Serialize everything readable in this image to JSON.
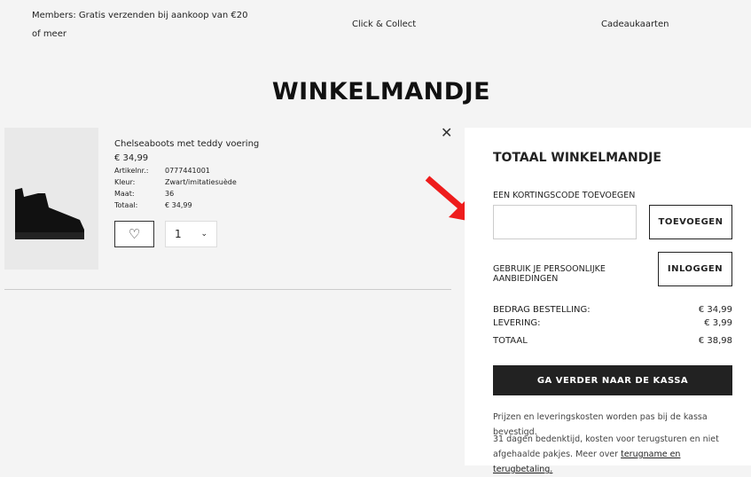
{
  "topbar": {
    "members": "Members: Gratis verzenden bij aankoop van €20",
    "members_2": "of meer",
    "click_collect": "Click & Collect",
    "giftcards": "Cadeaukaarten"
  },
  "page_title": "WINKELMANDJE",
  "item": {
    "name": "Chelseaboots met teddy voering",
    "price": "€ 34,99",
    "details": [
      {
        "label": "Artikelnr.:",
        "value": "0777441001"
      },
      {
        "label": "Kleur:",
        "value": "Zwart/imitatiesuède"
      },
      {
        "label": "Maat:",
        "value": "36"
      },
      {
        "label": "Totaal:",
        "value": "€ 34,99"
      }
    ],
    "quantity": "1"
  },
  "summary": {
    "title": "TOTAAL WINKELMANDJE",
    "discount_label": "EEN KORTINGSCODE TOEVOEGEN",
    "discount_placeholder": "",
    "add_button": "TOEVOEGEN",
    "offers_label": "GEBRUIK JE PERSOONLIJKE AANBIEDINGEN",
    "login_button": "INLOGGEN",
    "lines": [
      {
        "label": "BEDRAG BESTELLING:",
        "value": "€ 34,99"
      },
      {
        "label": "LEVERING:",
        "value": "€ 3,99"
      },
      {
        "label": "TOTAAL",
        "value": "€ 38,98"
      }
    ],
    "checkout_button": "GA VERDER NAAR DE KASSA",
    "note1": "Prijzen en leveringskosten worden pas bij de kassa bevestigd.",
    "note2": "31 dagen bedenktijd, kosten voor terugsturen en niet afgehaalde pakjes. Meer over",
    "note2_link": "terugname en terugbetaling."
  },
  "colors": {
    "annotation_arrow": "#ee1c1c"
  }
}
